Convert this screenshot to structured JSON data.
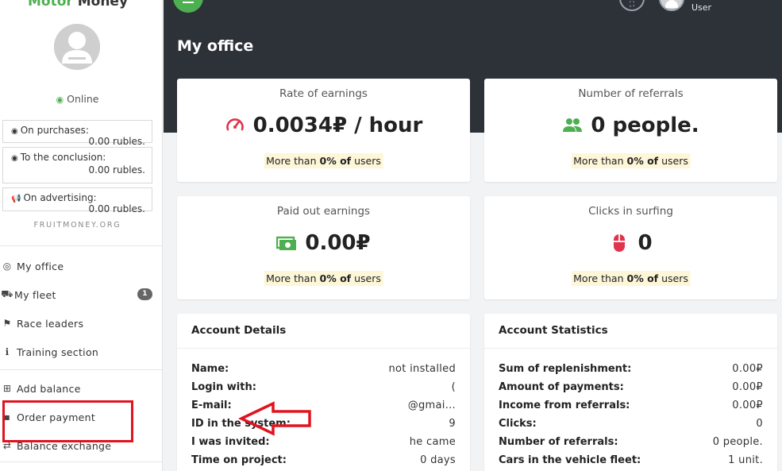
{
  "sidebar": {
    "logo": {
      "part1": "Motor",
      "part2": "Money"
    },
    "status": "Online",
    "balances": [
      {
        "label": "On purchases:",
        "amount": "0.00 rubles."
      },
      {
        "label": "To the conclusion:",
        "amount": "0.00 rubles."
      },
      {
        "label": "On advertising:",
        "amount": "0.00 rubles."
      }
    ],
    "site": "FRUITMONEY.ORG",
    "nav": [
      {
        "label": "My office",
        "icon": "user-circle-icon"
      },
      {
        "label": "My fleet",
        "icon": "car-icon",
        "badge": "1"
      },
      {
        "label": "Race leaders",
        "icon": "flag-icon"
      },
      {
        "label": "Training section",
        "icon": "info-icon"
      },
      {
        "label": "Add balance",
        "icon": "plus-square-icon"
      },
      {
        "label": "Order payment",
        "icon": "payment-icon"
      },
      {
        "label": "Balance exchange",
        "icon": "exchange-icon"
      }
    ]
  },
  "header": {
    "user_label": "User",
    "page_title": "My office"
  },
  "stats": [
    {
      "title": "Rate of earnings",
      "value": "0.0034₽ / hour",
      "note_prefix": "More than",
      "note_pct": "0% of",
      "note_suffix": "users",
      "icon": "speedometer-icon",
      "color": "#e0334c"
    },
    {
      "title": "Number of referrals",
      "value": "0 people.",
      "note_prefix": "More than",
      "note_pct": "0% of",
      "note_suffix": "users",
      "icon": "users-icon",
      "color": "#4caf50"
    },
    {
      "title": "Paid out earnings",
      "value": "0.00₽",
      "note_prefix": "More than",
      "note_pct": "0% of",
      "note_suffix": "users",
      "icon": "money-icon",
      "color": "#4caf50"
    },
    {
      "title": "Clicks in surfing",
      "value": "0",
      "note_prefix": "More than",
      "note_pct": "0% of",
      "note_suffix": "users",
      "icon": "mouse-icon",
      "color": "#e0334c"
    }
  ],
  "account_details": {
    "title": "Account Details",
    "rows": [
      {
        "k": "Name:",
        "v": "not installed"
      },
      {
        "k": "Login with:",
        "v": "("
      },
      {
        "k": "E-mail:",
        "v": "@gmai..."
      },
      {
        "k": "ID in the system:",
        "v": "9"
      },
      {
        "k": "I was invited:",
        "v": "he came"
      },
      {
        "k": "Time on project:",
        "v": "0 days"
      }
    ]
  },
  "account_statistics": {
    "title": "Account Statistics",
    "rows": [
      {
        "k": "Sum of replenishment:",
        "v": "0.00₽"
      },
      {
        "k": "Amount of payments:",
        "v": "0.00₽"
      },
      {
        "k": "Income from referrals:",
        "v": "0.00₽"
      },
      {
        "k": "Clicks:",
        "v": "0"
      },
      {
        "k": "Number of referrals:",
        "v": "0 people."
      },
      {
        "k": "Cars in the vehicle fleet:",
        "v": "1 unit."
      }
    ]
  },
  "annotation_color": "#e0141f"
}
